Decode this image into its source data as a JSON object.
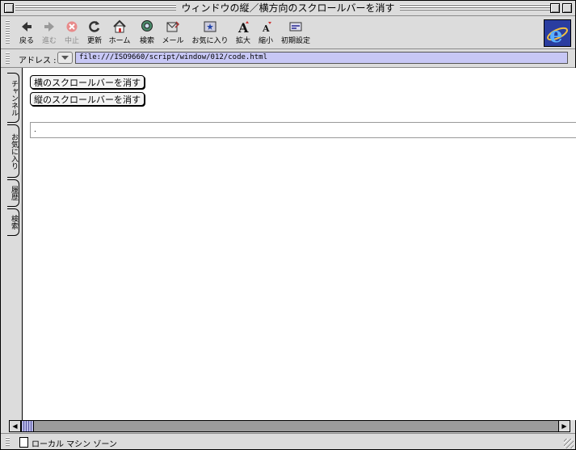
{
  "window": {
    "title": "ウィンドウの縦／横方向のスクロールバーを消す"
  },
  "toolbar": {
    "items": [
      {
        "label": "戻る",
        "icon": "back-arrow-icon"
      },
      {
        "label": "進む",
        "icon": "forward-arrow-icon"
      },
      {
        "label": "中止",
        "icon": "stop-icon"
      },
      {
        "label": "更新",
        "icon": "refresh-icon"
      },
      {
        "label": "ホーム",
        "icon": "home-icon"
      },
      {
        "label": "検索",
        "icon": "search-icon"
      },
      {
        "label": "メール",
        "icon": "mail-icon"
      },
      {
        "label": "お気に入り",
        "icon": "favorites-icon"
      },
      {
        "label": "拡大",
        "icon": "text-larger-icon"
      },
      {
        "label": "縮小",
        "icon": "text-smaller-icon"
      },
      {
        "label": "初期設定",
        "icon": "preferences-icon"
      }
    ]
  },
  "address": {
    "label": "アドレス :",
    "url": "file:///ISO9660/script/window/012/code.html"
  },
  "sidetabs": [
    "チャンネル",
    "お気に入り",
    "履歴",
    "検索"
  ],
  "content": {
    "buttons": [
      "横のスクロールバーを消す",
      "縦のスクロールバーを消す"
    ],
    "textfield_value": "."
  },
  "status": {
    "text": "ローカル マシン ゾーン"
  },
  "colors": {
    "chrome": "#dcdcdc",
    "address_field": "#c7c7f5",
    "ie_blue": "#2a3da0"
  }
}
